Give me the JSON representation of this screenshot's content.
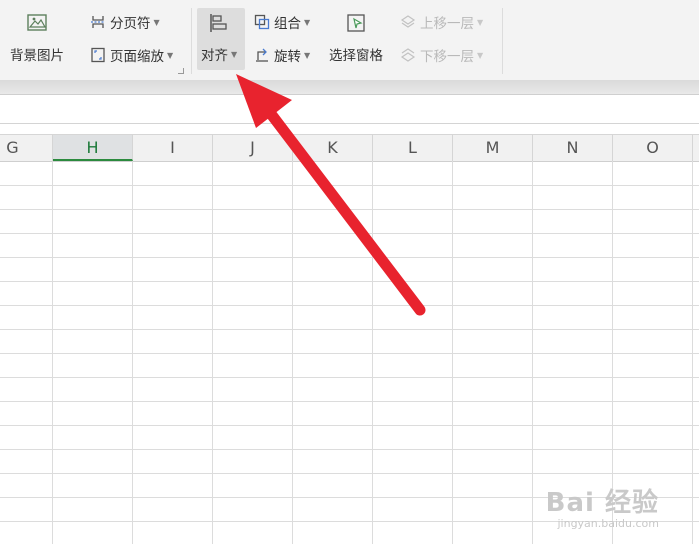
{
  "ribbon": {
    "background_image": "背景图片",
    "page_break": "分页符",
    "page_zoom": "页面缩放",
    "align": "对齐",
    "group": "组合",
    "rotate": "旋转",
    "selection_pane": "选择窗格",
    "bring_forward": "上移一层",
    "send_backward": "下移一层"
  },
  "columns": [
    "G",
    "H",
    "I",
    "J",
    "K",
    "L",
    "M",
    "N",
    "O"
  ],
  "active_column": "H",
  "watermark": {
    "brand_text": "Bai 经验",
    "url": "jingyan.baidu.com"
  },
  "colors": {
    "accent": "#2b8a3e",
    "arrow": "#e8232e"
  }
}
